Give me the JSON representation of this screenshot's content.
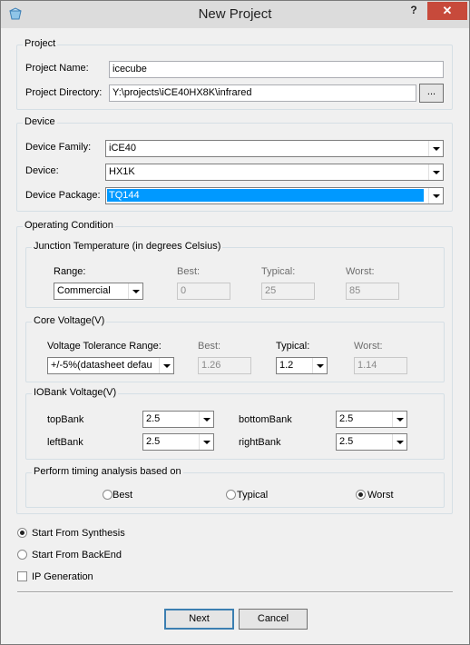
{
  "window": {
    "title": "New Project",
    "help_label": "?",
    "close_label": "✕"
  },
  "project": {
    "group_title": "Project",
    "name_label": "Project Name:",
    "name_value": "icecube",
    "dir_label": "Project Directory:",
    "dir_value": "Y:\\projects\\iCE40HX8K\\infrared",
    "browse_label": "..."
  },
  "device": {
    "group_title": "Device",
    "family_label": "Device Family:",
    "family_value": "iCE40",
    "device_label": "Device:",
    "device_value": "HX1K",
    "package_label": "Device Package:",
    "package_value": "TQ144"
  },
  "operating": {
    "group_title": "Operating Condition",
    "junction": {
      "title": "Junction Temperature (in degrees Celsius)",
      "range_label": "Range:",
      "range_value": "Commercial",
      "best_label": "Best:",
      "best_value": "0",
      "typical_label": "Typical:",
      "typical_value": "25",
      "worst_label": "Worst:",
      "worst_value": "85"
    },
    "core": {
      "title": "Core Voltage(V)",
      "tol_label": "Voltage Tolerance Range:",
      "tol_value": "+/-5%(datasheet defau",
      "best_label": "Best:",
      "best_value": "1.26",
      "typical_label": "Typical:",
      "typical_value": "1.2",
      "worst_label": "Worst:",
      "worst_value": "1.14"
    },
    "iobank": {
      "title": "IOBank Voltage(V)",
      "top_label": "topBank",
      "top_value": "2.5",
      "bottom_label": "bottomBank",
      "bottom_value": "2.5",
      "left_label": "leftBank",
      "left_value": "2.5",
      "right_label": "rightBank",
      "right_value": "2.5"
    },
    "timing": {
      "title": "Perform timing analysis based on",
      "best_label": "Best",
      "typical_label": "Typical",
      "worst_label": "Worst",
      "selected": "Worst"
    }
  },
  "start": {
    "synthesis_label": "Start From Synthesis",
    "backend_label": "Start From BackEnd",
    "ip_label": "IP Generation",
    "selected": "Start From Synthesis",
    "ip_checked": false
  },
  "buttons": {
    "next_label": "Next",
    "cancel_label": "Cancel"
  }
}
